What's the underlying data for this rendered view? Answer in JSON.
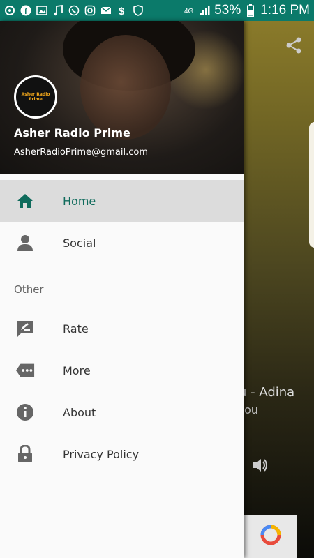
{
  "statusbar": {
    "battery": "53%",
    "time": "1:16 PM",
    "left_icons": [
      "settings-icon",
      "facebook-icon",
      "image-icon",
      "music-icon",
      "whatsapp-icon",
      "instagram-icon",
      "mail-icon",
      "dollar-icon",
      "wifi-shield-icon"
    ],
    "right_icons": [
      "wifi-icon",
      "signal-icon",
      "battery-icon"
    ]
  },
  "drawer": {
    "header": {
      "name": "Asher Radio Prime",
      "email": "AsherRadioPrime@gmail.com",
      "logo_text": "Asher Radio Prime"
    },
    "items": [
      {
        "label": "Home",
        "icon": "home-icon",
        "active": true
      },
      {
        "label": "Social",
        "icon": "person-icon",
        "active": false
      }
    ],
    "section_title": "Other",
    "other_items": [
      {
        "label": "Rate",
        "icon": "rate-icon"
      },
      {
        "label": "More",
        "icon": "more-icon"
      },
      {
        "label": "About",
        "icon": "info-icon"
      },
      {
        "label": "Privacy Policy",
        "icon": "lock-icon"
      }
    ]
  },
  "background": {
    "title_partial": "u  - Adina",
    "subtitle_partial": "ou"
  },
  "colors": {
    "accent": "#0b7a6a",
    "active_text": "#0f6b5c",
    "active_bg": "#dcdcdc"
  }
}
